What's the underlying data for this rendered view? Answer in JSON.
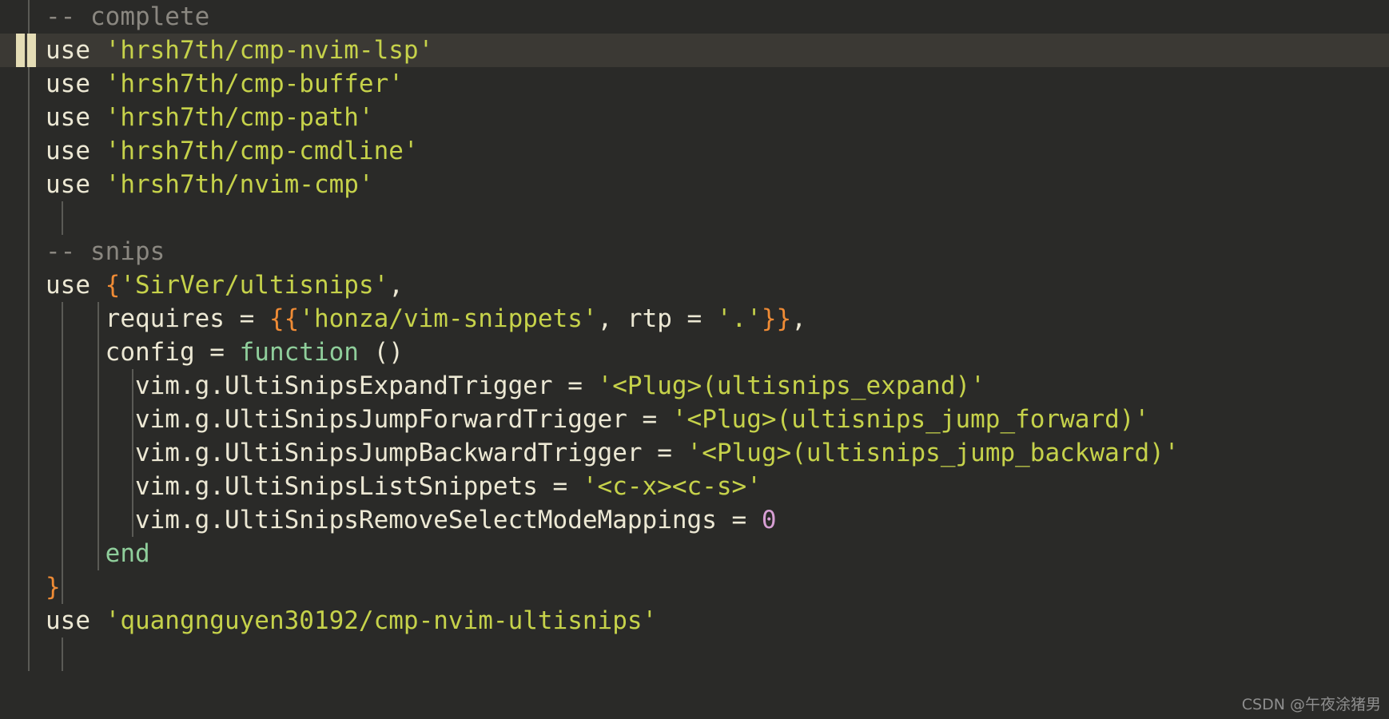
{
  "editor": {
    "name": "neovim-buffer",
    "filetype": "lua",
    "background": "#2a2a28",
    "cursorline_background": "#3b3934",
    "cursor_color": "#e4dcb5",
    "indent_guide_color": "#5a5a55",
    "colors": {
      "text": "#ece8d4",
      "string": "#c6d24a",
      "comment": "#8a8780",
      "keyword": "#8fce9b",
      "punctuation": "#ef8b35",
      "number": "#d79fd4"
    }
  },
  "lines": [
    {
      "n": 1,
      "indent_guides": [
        35
      ],
      "cursorline": false,
      "tokens": [
        {
          "t": "comment",
          "s": "-- complete"
        }
      ]
    },
    {
      "n": 2,
      "indent_guides": [],
      "cursorline": true,
      "tokens": [
        {
          "t": "ident",
          "s": "use "
        },
        {
          "t": "str",
          "s": "'hrsh7th/cmp-nvim-lsp'"
        }
      ]
    },
    {
      "n": 3,
      "indent_guides": [
        35
      ],
      "cursorline": false,
      "tokens": [
        {
          "t": "ident",
          "s": "use "
        },
        {
          "t": "str",
          "s": "'hrsh7th/cmp-buffer'"
        }
      ]
    },
    {
      "n": 4,
      "indent_guides": [
        35
      ],
      "cursorline": false,
      "tokens": [
        {
          "t": "ident",
          "s": "use "
        },
        {
          "t": "str",
          "s": "'hrsh7th/cmp-path'"
        }
      ]
    },
    {
      "n": 5,
      "indent_guides": [
        35
      ],
      "cursorline": false,
      "tokens": [
        {
          "t": "ident",
          "s": "use "
        },
        {
          "t": "str",
          "s": "'hrsh7th/cmp-cmdline'"
        }
      ]
    },
    {
      "n": 6,
      "indent_guides": [
        35
      ],
      "cursorline": false,
      "tokens": [
        {
          "t": "ident",
          "s": "use "
        },
        {
          "t": "str",
          "s": "'hrsh7th/nvim-cmp'"
        }
      ]
    },
    {
      "n": 7,
      "indent_guides": [
        35,
        77
      ],
      "cursorline": false,
      "tokens": []
    },
    {
      "n": 8,
      "indent_guides": [
        35
      ],
      "cursorline": false,
      "tokens": [
        {
          "t": "comment",
          "s": "-- snips"
        }
      ]
    },
    {
      "n": 9,
      "indent_guides": [
        35
      ],
      "cursorline": false,
      "tokens": [
        {
          "t": "ident",
          "s": "use "
        },
        {
          "t": "punc",
          "s": "{"
        },
        {
          "t": "str",
          "s": "'SirVer/ultisnips'"
        },
        {
          "t": "ident",
          "s": ","
        }
      ]
    },
    {
      "n": 10,
      "indent_guides": [
        35,
        77,
        122
      ],
      "cursorline": false,
      "tokens": [
        {
          "t": "ident",
          "s": "    requires = "
        },
        {
          "t": "punc",
          "s": "{{"
        },
        {
          "t": "str",
          "s": "'honza/vim-snippets'"
        },
        {
          "t": "ident",
          "s": ", rtp = "
        },
        {
          "t": "str",
          "s": "'.'"
        },
        {
          "t": "punc",
          "s": "}}"
        },
        {
          "t": "ident",
          "s": ","
        }
      ]
    },
    {
      "n": 11,
      "indent_guides": [
        35,
        77,
        122
      ],
      "cursorline": false,
      "tokens": [
        {
          "t": "ident",
          "s": "    config = "
        },
        {
          "t": "kw",
          "s": "function"
        },
        {
          "t": "ident",
          "s": " ()"
        }
      ]
    },
    {
      "n": 12,
      "indent_guides": [
        35,
        77,
        122,
        165
      ],
      "cursorline": false,
      "tokens": [
        {
          "t": "ident",
          "s": "      vim.g.UltiSnipsExpandTrigger = "
        },
        {
          "t": "str",
          "s": "'<Plug>(ultisnips_expand)'"
        }
      ]
    },
    {
      "n": 13,
      "indent_guides": [
        35,
        77,
        122,
        165
      ],
      "cursorline": false,
      "tokens": [
        {
          "t": "ident",
          "s": "      vim.g.UltiSnipsJumpForwardTrigger = "
        },
        {
          "t": "str",
          "s": "'<Plug>(ultisnips_jump_forward)'"
        }
      ]
    },
    {
      "n": 14,
      "indent_guides": [
        35,
        77,
        122,
        165
      ],
      "cursorline": false,
      "tokens": [
        {
          "t": "ident",
          "s": "      vim.g.UltiSnipsJumpBackwardTrigger = "
        },
        {
          "t": "str",
          "s": "'<Plug>(ultisnips_jump_backward)'"
        }
      ]
    },
    {
      "n": 15,
      "indent_guides": [
        35,
        77,
        122,
        165
      ],
      "cursorline": false,
      "tokens": [
        {
          "t": "ident",
          "s": "      vim.g.UltiSnipsListSnippets = "
        },
        {
          "t": "str",
          "s": "'<c-x><c-s>'"
        }
      ]
    },
    {
      "n": 16,
      "indent_guides": [
        35,
        77,
        122,
        165
      ],
      "cursorline": false,
      "tokens": [
        {
          "t": "ident",
          "s": "      vim.g.UltiSnipsRemoveSelectModeMappings = "
        },
        {
          "t": "num",
          "s": "0"
        }
      ]
    },
    {
      "n": 17,
      "indent_guides": [
        35,
        77,
        122
      ],
      "cursorline": false,
      "tokens": [
        {
          "t": "ident",
          "s": "    "
        },
        {
          "t": "kw",
          "s": "end"
        }
      ]
    },
    {
      "n": 18,
      "indent_guides": [
        35,
        77
      ],
      "cursorline": false,
      "tokens": [
        {
          "t": "punc",
          "s": "}"
        }
      ]
    },
    {
      "n": 19,
      "indent_guides": [
        35
      ],
      "cursorline": false,
      "tokens": [
        {
          "t": "ident",
          "s": "use "
        },
        {
          "t": "str",
          "s": "'quangnguyen30192/cmp-nvim-ultisnips'"
        }
      ]
    },
    {
      "n": 20,
      "indent_guides": [
        35,
        77
      ],
      "cursorline": false,
      "tokens": []
    }
  ],
  "cursor": {
    "bars": [
      {
        "x": 20,
        "width": 11
      },
      {
        "x": 34,
        "width": 11
      }
    ],
    "line": 2
  },
  "watermark": {
    "text": "CSDN @午夜涂猪男"
  }
}
